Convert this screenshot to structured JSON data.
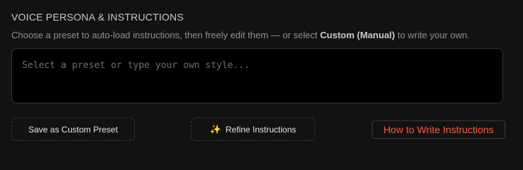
{
  "section": {
    "title": "VOICE PERSONA & INSTRUCTIONS",
    "description_before": "Choose a preset to auto-load instructions, then freely edit them — or select ",
    "description_bold": "Custom (Manual)",
    "description_after": " to write your own."
  },
  "instructions": {
    "value": "",
    "placeholder": "Select a preset or type your own style..."
  },
  "buttons": {
    "save_preset": "Save as Custom Preset",
    "refine": "Refine Instructions",
    "refine_icon": "sparkle-icon",
    "how_to": "How to Write Instructions"
  },
  "colors": {
    "background": "#121212",
    "accent_link": "#ff5a3c",
    "sparkle": "#f0a35a"
  }
}
